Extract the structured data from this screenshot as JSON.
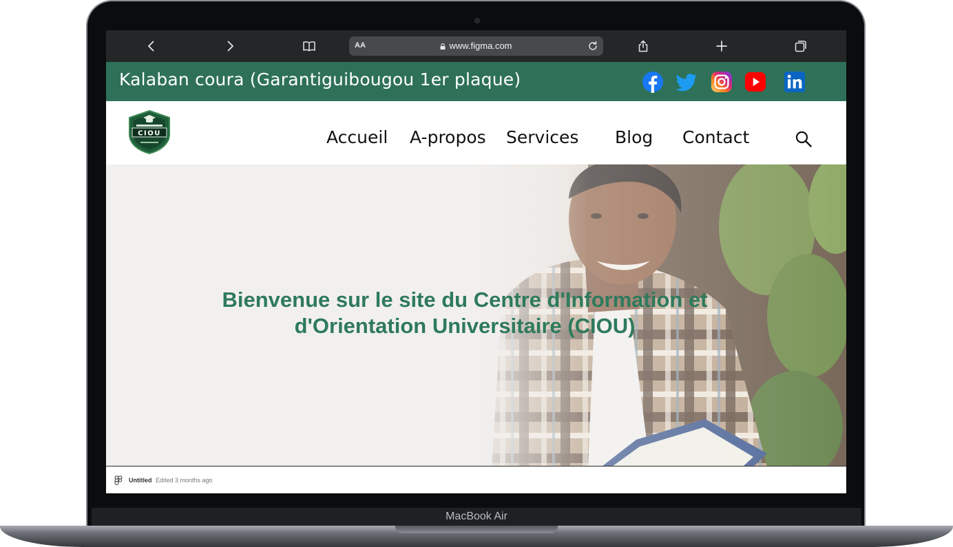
{
  "device": {
    "label": "MacBook Air"
  },
  "browser": {
    "address_aa": "AA",
    "url": "www.figma.com",
    "icons": [
      "back-icon",
      "forward-icon",
      "book-icon",
      "lock-icon",
      "reload-icon",
      "share-icon",
      "plus-icon",
      "tabs-icon"
    ]
  },
  "topbar": {
    "address": "Kalaban coura (Garantiguibougou 1er plaque)",
    "background": "#2e7158",
    "social": [
      "facebook-icon",
      "twitter-icon",
      "instagram-icon",
      "youtube-icon",
      "linkedin-icon"
    ]
  },
  "logo": {
    "text": "CIOU"
  },
  "nav": {
    "items": [
      "Accueil",
      "A-propos",
      "Services",
      "Blog",
      "Contact"
    ]
  },
  "hero": {
    "title": "Bienvenue sur le site du Centre d'Information et d'Orientation Universitaire (CIOU)",
    "title_color": "#2e7a5c"
  },
  "footer": {
    "file_name": "Untitled",
    "edited": "Edited 3 months ago"
  }
}
